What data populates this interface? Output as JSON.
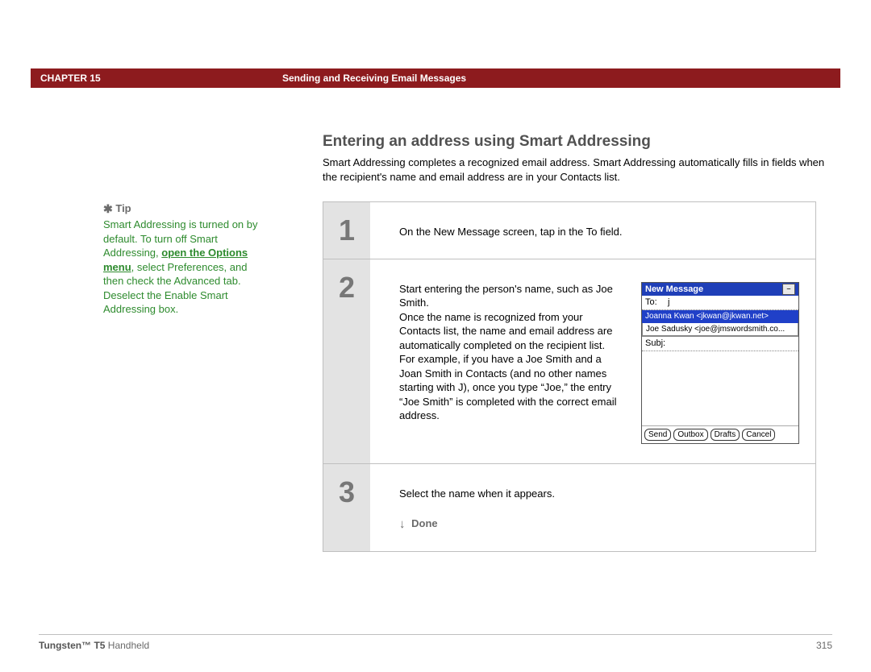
{
  "header": {
    "chapter": "CHAPTER 15",
    "title": "Sending and Receiving Email Messages"
  },
  "page": {
    "title": "Entering an address using Smart Addressing",
    "intro": "Smart Addressing completes a recognized email address. Smart Addressing automatically fills in fields when the recipient's name and email address are in your Contacts list."
  },
  "tip": {
    "label": "Tip",
    "text_before": "Smart Addressing is turned on by default. To turn off Smart Addressing, ",
    "link": "open the Options menu",
    "text_after": ", select Preferences, and then check the Advanced tab. Deselect the Enable Smart Addressing box."
  },
  "steps": [
    {
      "n": "1",
      "text": "On the New Message screen, tap in the To field."
    },
    {
      "n": "2",
      "text": "Start entering the person's name, such as Joe Smith.\nOnce the name is recognized from your Contacts list, the name and email address are automatically completed on the recipient list. For example, if you have a Joe Smith and a Joan Smith in Contacts (and no other names starting with J), once you type “Joe,” the entry “Joe Smith” is completed with the correct email address."
    },
    {
      "n": "3",
      "text": "Select the name when it appears."
    }
  ],
  "done_label": "Done",
  "pda": {
    "title": "New Message",
    "to_label": "To:",
    "to_value": "j",
    "selected": "Joanna Kwan <jkwan@jkwan.net>",
    "option": "Joe Sadusky <joe@jmswordsmith.co...",
    "subj_label": "Subj:",
    "buttons": [
      "Send",
      "Outbox",
      "Drafts",
      "Cancel"
    ]
  },
  "footer": {
    "product_bold": "Tungsten™ T5",
    "product_rest": " Handheld",
    "page": "315"
  }
}
